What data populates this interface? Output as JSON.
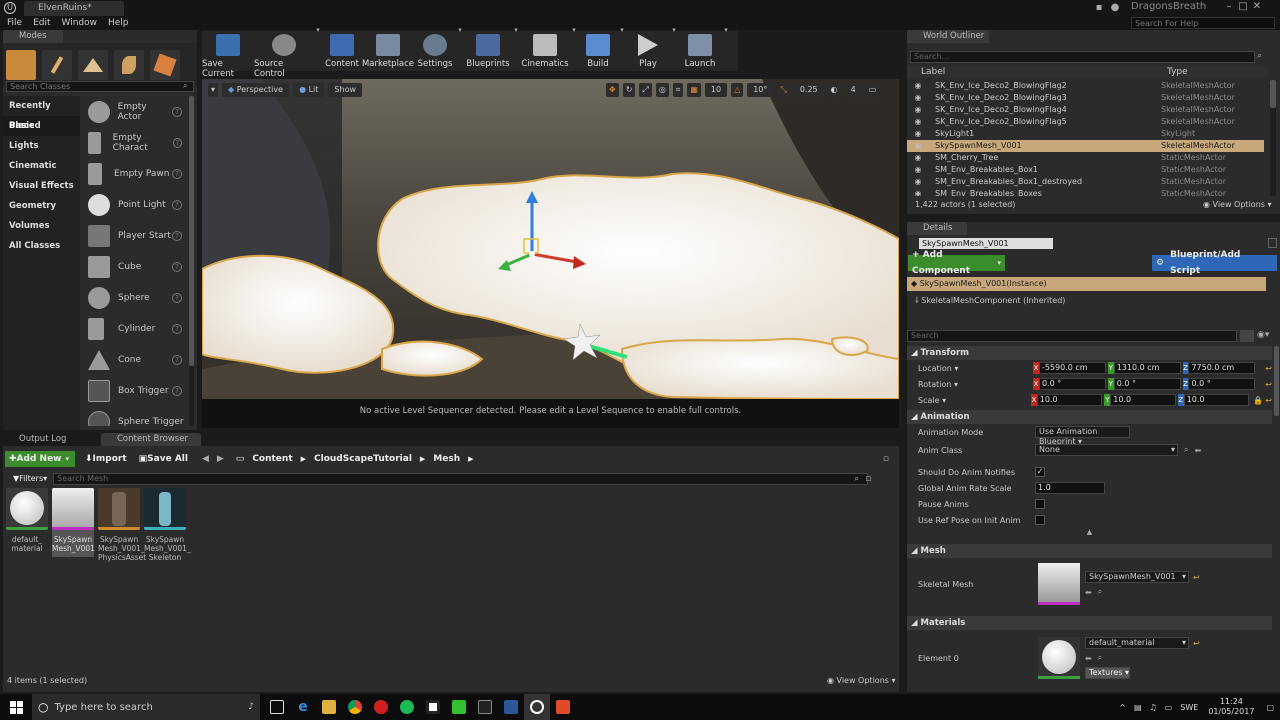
{
  "app": {
    "tab_title": "ElvenRuins*",
    "project_name": "DragonsBreath",
    "search_help_placeholder": "Search For Help",
    "menu": [
      "File",
      "Edit",
      "Window",
      "Help"
    ]
  },
  "modes": {
    "title": "Modes",
    "search_placeholder": "Search Classes",
    "categories": [
      "Recently Placed",
      "Basic",
      "Lights",
      "Cinematic",
      "Visual Effects",
      "Geometry",
      "Volumes",
      "All Classes"
    ],
    "selected_category": "Basic",
    "items": [
      "Empty Actor",
      "Empty Charact",
      "Empty Pawn",
      "Point Light",
      "Player Start",
      "Cube",
      "Sphere",
      "Cylinder",
      "Cone",
      "Box Trigger",
      "Sphere Trigger"
    ]
  },
  "toolbar": {
    "buttons": [
      "Save Current",
      "Source Control",
      "Content",
      "Marketplace",
      "Settings",
      "Blueprints",
      "Cinematics",
      "Build",
      "Play",
      "Launch"
    ]
  },
  "viewport": {
    "perspective": "Perspective",
    "lit": "Lit",
    "show": "Show",
    "grid_snap": "10",
    "rot_snap": "10°",
    "scale_snap": "0.25",
    "cam_speed": "4",
    "message": "No active Level Sequencer detected. Please edit a Level Sequence to enable full controls."
  },
  "outliner": {
    "title": "World Outliner",
    "search_placeholder": "Search...",
    "col_label": "Label",
    "col_type": "Type",
    "rows": [
      {
        "label": "SK_Env_Ice_Deco2_BlowingFlag2",
        "type": "SkeletalMeshActor"
      },
      {
        "label": "SK_Env_Ice_Deco2_BlowingFlag3",
        "type": "SkeletalMeshActor"
      },
      {
        "label": "SK_Env_Ice_Deco2_BlowingFlag4",
        "type": "SkeletalMeshActor"
      },
      {
        "label": "SK_Env_Ice_Deco2_BlowingFlag5",
        "type": "SkeletalMeshActor"
      },
      {
        "label": "SkyLight1",
        "type": "SkyLight"
      },
      {
        "label": "SkySpawnMesh_V001",
        "type": "SkeletalMeshActor"
      },
      {
        "label": "SM_Cherry_Tree",
        "type": "StaticMeshActor"
      },
      {
        "label": "SM_Env_Breakables_Box1",
        "type": "StaticMeshActor"
      },
      {
        "label": "SM_Env_Breakables_Box1_destroyed",
        "type": "StaticMeshActor"
      },
      {
        "label": "SM_Env_Breakables_Boxes",
        "type": "StaticMeshActor"
      }
    ],
    "status": "1,422 actors (1 selected)",
    "view_options": "View Options"
  },
  "details": {
    "title": "Details",
    "name_value": "SkySpawnMesh_V001",
    "add_component": "+ Add Component",
    "blueprint_script": "Blueprint/Add Script",
    "instance_label": "SkySpawnMesh_V001(Instance)",
    "component_label": "SkeletalMeshComponent (Inherited)",
    "search_placeholder": "Search",
    "transform_header": "Transform",
    "location_label": "Location",
    "location": [
      "-5590.0 cm",
      "1310.0 cm",
      "7750.0 cm"
    ],
    "rotation_label": "Rotation",
    "rotation": [
      "0.0 °",
      "0.0 °",
      "0.0 °"
    ],
    "scale_label": "Scale",
    "scale": [
      "10.0",
      "10.0",
      "10.0"
    ],
    "animation_header": "Animation",
    "anim_mode_label": "Animation Mode",
    "anim_mode_value": "Use Animation Blueprint",
    "anim_class_label": "Anim Class",
    "anim_class_value": "None",
    "should_do_label": "Should Do Anim Notifies",
    "global_rate_label": "Global Anim Rate Scale",
    "global_rate_value": "1.0",
    "pause_label": "Pause Anims",
    "ref_pose_label": "Use Ref Pose on Init Anim",
    "mesh_header": "Mesh",
    "skeletal_mesh_label": "Skeletal Mesh",
    "skeletal_mesh_value": "SkySpawnMesh_V001",
    "materials_header": "Materials",
    "element0_label": "Element 0",
    "element0_value": "default_material",
    "textures_btn": "Textures"
  },
  "bottom_tabs": [
    "Output Log",
    "Content Browser"
  ],
  "content_browser": {
    "add_new": "Add New",
    "import": "Import",
    "save_all": "Save All",
    "path": [
      "Content",
      "CloudScapeTutorial",
      "Mesh"
    ],
    "filters": "Filters",
    "search_placeholder": "Search Mesh",
    "assets": [
      "default_ material",
      "SkySpawn Mesh_V001",
      "SkySpawn Mesh_V001_ PhysicsAsset",
      "SkySpawn Mesh_V001_ Skeleton"
    ],
    "status": "4 items (1 selected)",
    "view_options": "View Options"
  },
  "taskbar": {
    "search_placeholder": "Type here to search",
    "lang": "SWE",
    "time": "11:24",
    "date": "01/05/2017"
  }
}
